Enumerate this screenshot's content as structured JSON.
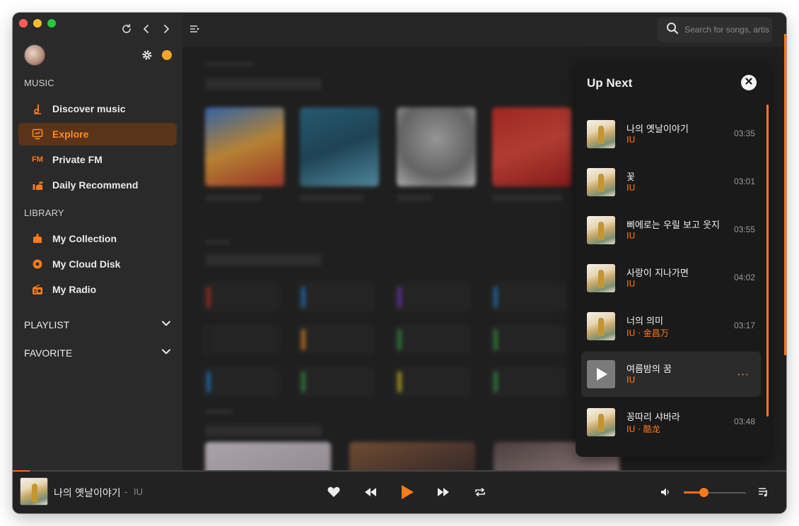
{
  "sidebar": {
    "music_section": "MUSIC",
    "library_section": "LIBRARY",
    "items": [
      {
        "label": "Discover music",
        "icon": "music-note-icon"
      },
      {
        "label": "Explore",
        "icon": "explore-icon",
        "active": true
      },
      {
        "label": "Private FM",
        "icon": "fm-icon",
        "icon_text": "FM"
      },
      {
        "label": "Daily Recommend",
        "icon": "daily-recommend-icon"
      },
      {
        "label": "My Collection",
        "icon": "collection-icon"
      },
      {
        "label": "My Cloud Disk",
        "icon": "cloud-disk-icon"
      },
      {
        "label": "My Radio",
        "icon": "radio-icon"
      }
    ],
    "playlist": "PLAYLIST",
    "favorite": "FAVORITE"
  },
  "search": {
    "placeholder": "Search for songs, artists"
  },
  "up_next": {
    "title": "Up Next",
    "tracks": [
      {
        "title": "나의 옛날이야기",
        "artist": "IU",
        "duration": "03:35"
      },
      {
        "title": "꽃",
        "artist": "IU",
        "duration": "03:01"
      },
      {
        "title": "삐에로는 우릴 보고 웃지",
        "artist": "IU",
        "duration": "03:55"
      },
      {
        "title": "사랑이 지나가면",
        "artist": "IU",
        "duration": "04:02"
      },
      {
        "title": "너의 의미",
        "artist": "IU · 金昌万",
        "duration": "03:17"
      },
      {
        "title": "여름밤의 꿈",
        "artist": "IU",
        "duration": "",
        "more": "···",
        "hovered": true
      },
      {
        "title": "꽁따리 샤바라",
        "artist": "IU · 酷龙",
        "duration": "03:48"
      }
    ]
  },
  "player": {
    "title": "나의 옛날이야기",
    "separator": "-",
    "artist": "IU",
    "progress": 0.022,
    "volume": 0.32
  },
  "colors": {
    "accent": "#ff7a1a",
    "active_bg": "#5a3419"
  }
}
